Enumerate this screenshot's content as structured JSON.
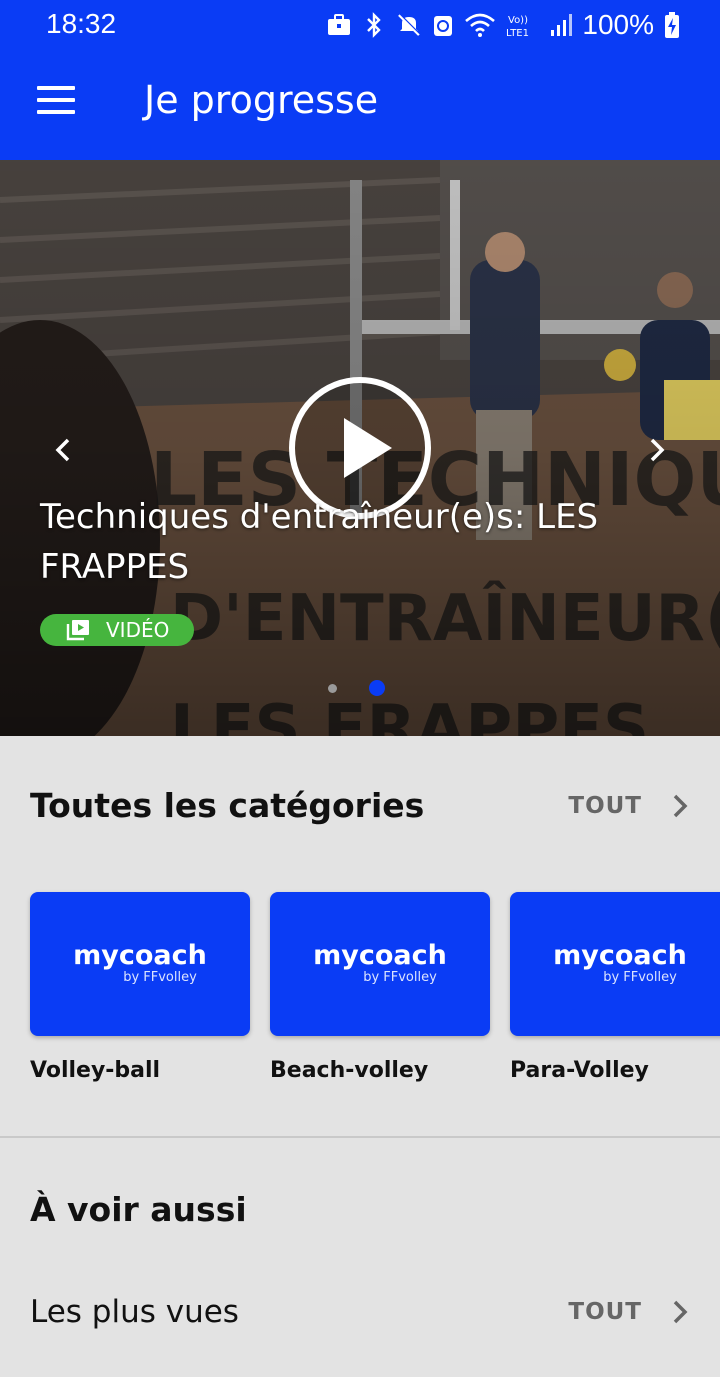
{
  "status_bar": {
    "time": "18:32",
    "battery": "100%",
    "icons": [
      "briefcase-icon",
      "bluetooth-icon",
      "mute-icon",
      "recycle-icon",
      "wifi-icon",
      "volte-icon",
      "signal-icon",
      "battery-icon"
    ]
  },
  "app_bar": {
    "title": "Je progresse"
  },
  "hero": {
    "caption": "Techniques d'entraîneur(e)s: LES FRAPPES",
    "badge": "VIDÉO",
    "slide_count": 2,
    "active_slide": 2
  },
  "categories": {
    "title": "Toutes les catégories",
    "see_all": "TOUT",
    "logo_main": "mycoach",
    "logo_sub": "by FFvolley",
    "items": [
      {
        "label": "Volley-ball"
      },
      {
        "label": "Beach-volley"
      },
      {
        "label": "Para-Volley"
      }
    ]
  },
  "see_also": {
    "title": "À voir aussi"
  },
  "most_viewed": {
    "title": "Les plus vues",
    "see_all": "TOUT"
  },
  "colors": {
    "primary": "#0a3cf5",
    "badge": "#46b53e",
    "background": "#e3e3e3"
  }
}
